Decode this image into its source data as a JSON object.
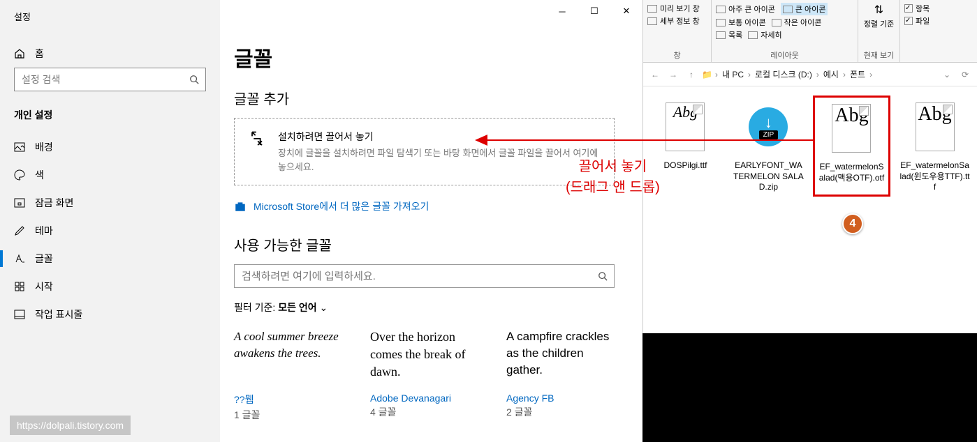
{
  "settings": {
    "window_title": "설정",
    "home": "홈",
    "search_placeholder": "설정 검색",
    "group": "개인 설정",
    "nav": {
      "background": "배경",
      "color": "색",
      "lockscreen": "잠금 화면",
      "theme": "테마",
      "fonts": "글꼴",
      "start": "시작",
      "taskbar": "작업 표시줄"
    },
    "watermark": "https://dolpali.tistory.com"
  },
  "fonts_page": {
    "title": "글꼴",
    "add_title": "글꼴 추가",
    "drop_title": "설치하려면 끌어서 놓기",
    "drop_desc": "장치에 글꼴을 설치하려면 파일 탐색기 또는 바탕 화면에서 글꼴 파일을 끌어서 여기에 놓으세요.",
    "store_link": "Microsoft Store에서 더 많은 글꼴 가져오기",
    "available_title": "사용 가능한 글꼴",
    "search_placeholder": "검색하려면 여기에 입력하세요.",
    "filter_label": "필터 기준:",
    "filter_value": "모든 언어",
    "cards": [
      {
        "sample": "A cool summer breeze awakens the trees.",
        "name": "??뭼",
        "count": "1 글꼴"
      },
      {
        "sample": "Over the horizon comes the break of dawn.",
        "name": "Adobe Devanagari",
        "count": "4 글꼴"
      },
      {
        "sample": "A campfire crackles as the children gather.",
        "name": "Agency FB",
        "count": "2 글꼴"
      }
    ]
  },
  "annotation": {
    "line1": "끌어서 놓기",
    "line2": "(드래그 앤 드롭)",
    "badge": "4"
  },
  "explorer": {
    "ribbon": {
      "preview": "미리 보기 창",
      "details_pane": "세부 정보 창",
      "pane_group": "창",
      "view_xl": "아주 큰 아이콘",
      "view_l": "큰 아이콘",
      "view_m": "보통 아이콘",
      "view_s": "작은 아이콘",
      "view_list": "목록",
      "view_detail": "자세히",
      "layout_group": "레이아웃",
      "sort": "정렬 기준",
      "current_group": "현재 보기",
      "chk1": "항목",
      "chk2": "파일"
    },
    "breadcrumb": {
      "pc": "내 PC",
      "drive": "로컬 디스크 (D:)",
      "folder1": "예시",
      "folder2": "폰트"
    },
    "files": [
      {
        "name": "DOSPilgi.ttf",
        "type": "font-script",
        "label": "Abg"
      },
      {
        "name": "EARLYFONT_WATERMELON SALAD.zip",
        "type": "zip",
        "label": "ZIP"
      },
      {
        "name": "EF_watermelonSalad(맥용OTF).otf",
        "type": "font",
        "label": "Abg"
      },
      {
        "name": "EF_watermelonSalad(윈도우용TTF).ttf",
        "type": "font",
        "label": "Abg"
      }
    ]
  }
}
